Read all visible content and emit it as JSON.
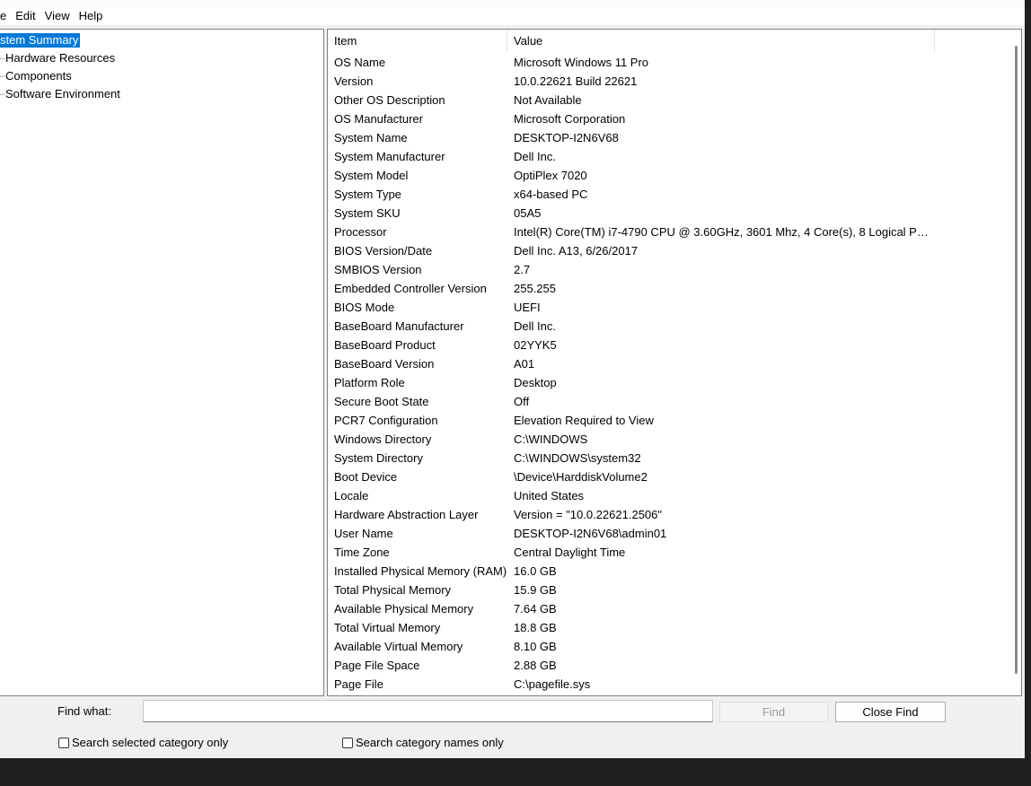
{
  "menu": [
    "e",
    "Edit",
    "View",
    "Help"
  ],
  "tree": {
    "items": [
      {
        "label": "stem Summary",
        "selected": true
      },
      {
        "label": "Hardware Resources"
      },
      {
        "label": "Components"
      },
      {
        "label": "Software Environment"
      }
    ]
  },
  "list": {
    "headers": {
      "item": "Item",
      "value": "Value"
    },
    "rows": [
      [
        "OS Name",
        "Microsoft Windows 11 Pro"
      ],
      [
        "Version",
        "10.0.22621 Build 22621"
      ],
      [
        "Other OS Description",
        "Not Available"
      ],
      [
        "OS Manufacturer",
        "Microsoft Corporation"
      ],
      [
        "System Name",
        "DESKTOP-I2N6V68"
      ],
      [
        "System Manufacturer",
        "Dell Inc."
      ],
      [
        "System Model",
        "OptiPlex 7020"
      ],
      [
        "System Type",
        "x64-based PC"
      ],
      [
        "System SKU",
        "05A5"
      ],
      [
        "Processor",
        "Intel(R) Core(TM) i7-4790 CPU @ 3.60GHz, 3601 Mhz, 4 Core(s), 8 Logical Pro..."
      ],
      [
        "BIOS Version/Date",
        "Dell Inc. A13, 6/26/2017"
      ],
      [
        "SMBIOS Version",
        "2.7"
      ],
      [
        "Embedded Controller Version",
        "255.255"
      ],
      [
        "BIOS Mode",
        "UEFI"
      ],
      [
        "BaseBoard Manufacturer",
        "Dell Inc."
      ],
      [
        "BaseBoard Product",
        "02YYK5"
      ],
      [
        "BaseBoard Version",
        "A01"
      ],
      [
        "Platform Role",
        "Desktop"
      ],
      [
        "Secure Boot State",
        "Off"
      ],
      [
        "PCR7 Configuration",
        "Elevation Required to View"
      ],
      [
        "Windows Directory",
        "C:\\WINDOWS"
      ],
      [
        "System Directory",
        "C:\\WINDOWS\\system32"
      ],
      [
        "Boot Device",
        "\\Device\\HarddiskVolume2"
      ],
      [
        "Locale",
        "United States"
      ],
      [
        "Hardware Abstraction Layer",
        "Version = \"10.0.22621.2506\""
      ],
      [
        "User Name",
        "DESKTOP-I2N6V68\\admin01"
      ],
      [
        "Time Zone",
        "Central Daylight Time"
      ],
      [
        "Installed Physical Memory (RAM)",
        "16.0 GB"
      ],
      [
        "Total Physical Memory",
        "15.9 GB"
      ],
      [
        "Available Physical Memory",
        "7.64 GB"
      ],
      [
        "Total Virtual Memory",
        "18.8 GB"
      ],
      [
        "Available Virtual Memory",
        "8.10 GB"
      ],
      [
        "Page File Space",
        "2.88 GB"
      ],
      [
        "Page File",
        "C:\\pagefile.sys"
      ]
    ]
  },
  "find": {
    "label": "Find what:",
    "value": "",
    "find_button": "Find",
    "close_button": "Close Find",
    "check_selected": "Search selected category only",
    "check_names": "Search category names only"
  },
  "colors": {
    "selection": "#0078d7"
  }
}
